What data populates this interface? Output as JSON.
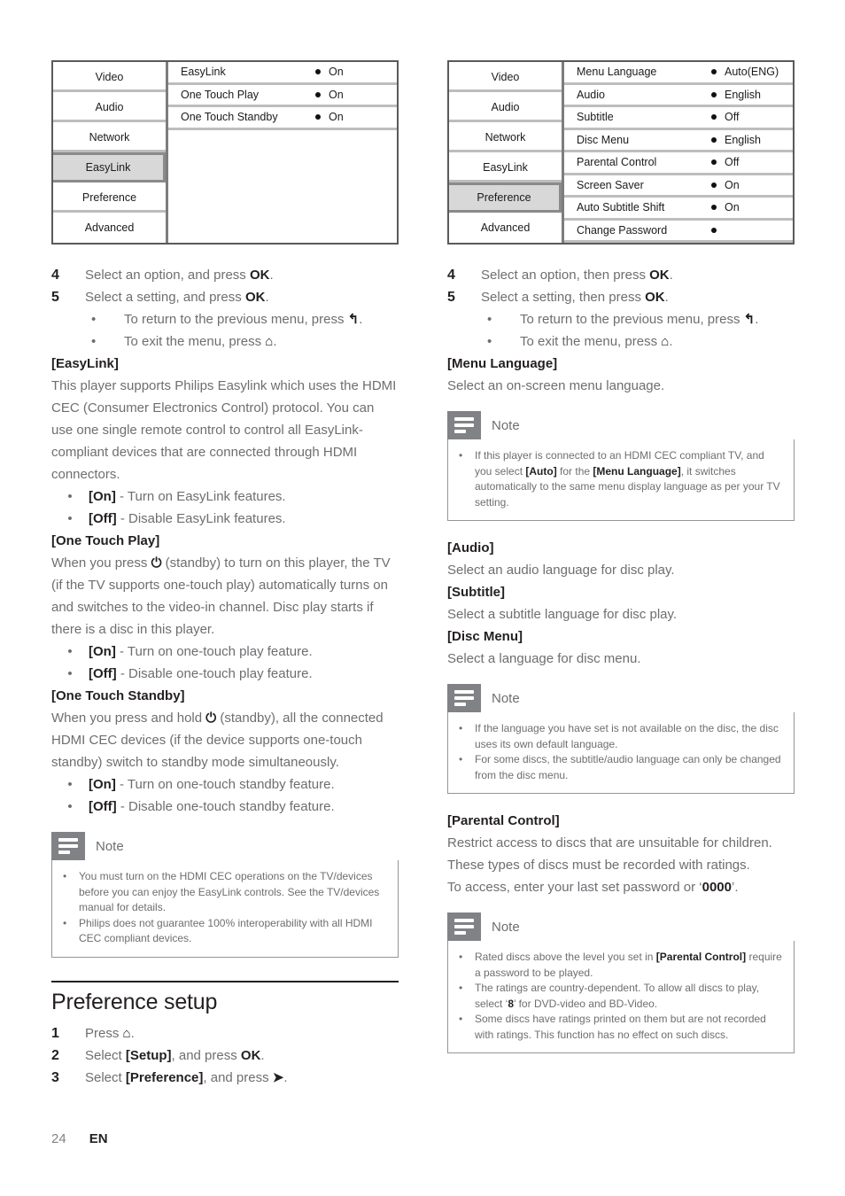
{
  "page": {
    "number": "24",
    "language": "EN"
  },
  "icons": {
    "ok": "OK",
    "return": "↰",
    "home": "⌂",
    "standby": "⏻",
    "right_arrow": "➤"
  },
  "left_column": {
    "menu_screenshot": {
      "categories": [
        {
          "label": "Video",
          "selected": false
        },
        {
          "label": "Audio",
          "selected": false
        },
        {
          "label": "Network",
          "selected": false
        },
        {
          "label": "EasyLink",
          "selected": true
        },
        {
          "label": "Preference",
          "selected": false
        },
        {
          "label": "Advanced",
          "selected": false
        }
      ],
      "options": [
        {
          "label": "EasyLink",
          "value": "On"
        },
        {
          "label": "One Touch Play",
          "value": "On"
        },
        {
          "label": "One Touch Standby",
          "value": "On"
        }
      ]
    },
    "steps": [
      {
        "num": "4",
        "pre": "Select an option, and press ",
        "bold": "OK",
        "post": "."
      },
      {
        "num": "5",
        "pre": "Select a setting, and press ",
        "bold": "OK",
        "post": "."
      }
    ],
    "sub_bullets": [
      {
        "pre": "To return to the previous menu, press ",
        "icon": "return",
        "post": "."
      },
      {
        "pre": "To exit the menu, press ",
        "icon": "home",
        "post": "."
      }
    ],
    "sections": [
      {
        "term": "[EasyLink]",
        "paragraph": "This player supports Philips Easylink which uses the HDMI CEC (Consumer Electronics Control) protocol. You can use one single remote control to control all EasyLink-compliant devices that are connected through HDMI connectors.",
        "bullets": [
          {
            "bold": "[On]",
            "rest": " - Turn on EasyLink features."
          },
          {
            "bold": "[Off]",
            "rest": " - Disable EasyLink features."
          }
        ]
      },
      {
        "term": "[One Touch Play]",
        "paragraph_pre": "When you press ",
        "paragraph_icon": "standby",
        "paragraph_post": " (standby) to turn on this player, the TV (if the TV supports one-touch play) automatically turns on and switches to the video-in channel. Disc play starts if there is a disc in this player.",
        "bullets": [
          {
            "bold": "[On]",
            "rest": " - Turn on one-touch play feature."
          },
          {
            "bold": "[Off]",
            "rest": " - Disable one-touch play feature."
          }
        ]
      },
      {
        "term": "[One Touch Standby]",
        "paragraph_pre": "When you press and hold ",
        "paragraph_icon": "standby",
        "paragraph_post": " (standby), all the connected HDMI CEC devices (if the device supports one-touch standby) switch to standby mode simultaneously.",
        "bullets": [
          {
            "bold": "[On]",
            "rest": " - Turn on one-touch standby feature."
          },
          {
            "bold": "[Off]",
            "rest": " - Disable one-touch standby feature."
          }
        ]
      }
    ],
    "note": {
      "title": "Note",
      "items": [
        "You must turn on the HDMI CEC operations on the TV/devices before you can enjoy the EasyLink controls. See the TV/devices manual for details.",
        "Philips does not guarantee 100% interoperability with all HDMI CEC compliant devices."
      ]
    },
    "section_heading": "Preference setup",
    "setup_steps": [
      {
        "num": "1",
        "pre": "Press ",
        "icon": "home",
        "post": "."
      },
      {
        "num": "2",
        "pre": "Select ",
        "bold": "[Setup]",
        "mid": ", and press ",
        "bold2": "OK",
        "post": "."
      },
      {
        "num": "3",
        "pre": "Select ",
        "bold": "[Preference]",
        "mid": ", and press ",
        "icon": "right_arrow",
        "post": "."
      }
    ]
  },
  "right_column": {
    "menu_screenshot": {
      "categories": [
        {
          "label": "Video",
          "selected": false
        },
        {
          "label": "Audio",
          "selected": false
        },
        {
          "label": "Network",
          "selected": false
        },
        {
          "label": "EasyLink",
          "selected": false
        },
        {
          "label": "Preference",
          "selected": true
        },
        {
          "label": "Advanced",
          "selected": false
        }
      ],
      "options": [
        {
          "label": "Menu Language",
          "value": "Auto(ENG)"
        },
        {
          "label": "Audio",
          "value": "English"
        },
        {
          "label": "Subtitle",
          "value": "Off"
        },
        {
          "label": "Disc Menu",
          "value": "English"
        },
        {
          "label": "Parental Control",
          "value": "Off"
        },
        {
          "label": "Screen Saver",
          "value": "On"
        },
        {
          "label": "Auto Subtitle Shift",
          "value": "On"
        },
        {
          "label": "Change Password",
          "value": ""
        }
      ]
    },
    "steps": [
      {
        "num": "4",
        "pre": "Select an option, then press ",
        "bold": "OK",
        "post": "."
      },
      {
        "num": "5",
        "pre": "Select a setting, then press ",
        "bold": "OK",
        "post": "."
      }
    ],
    "sub_bullets": [
      {
        "pre": "To return to the previous menu, press ",
        "icon": "return",
        "post": "."
      },
      {
        "pre": "To exit the menu, press ",
        "icon": "home",
        "post": "."
      }
    ],
    "menu_language": {
      "term": "[Menu Language]",
      "paragraph": "Select an on-screen menu language."
    },
    "note1": {
      "title": "Note",
      "item": {
        "p1": "If this player is connected to an HDMI CEC compliant TV, and you select ",
        "b1": "[Auto]",
        "p2": " for the ",
        "b2": "[Menu Language]",
        "p3": ", it switches automatically to the same menu display language as per your TV setting."
      }
    },
    "language_sections": [
      {
        "term": "[Audio]",
        "paragraph": "Select an audio language for disc play."
      },
      {
        "term": "[Subtitle]",
        "paragraph": "Select a subtitle language for disc play."
      },
      {
        "term": "[Disc Menu]",
        "paragraph": "Select a language for disc menu."
      }
    ],
    "note2": {
      "title": "Note",
      "items": [
        "If the language you have set is not available on the disc, the disc uses its own default language.",
        "For some discs, the subtitle/audio language can only be changed from the disc menu."
      ]
    },
    "parental": {
      "term": "[Parental Control]",
      "paragraph": "Restrict access to discs that are unsuitable for children. These types of discs must be recorded with ratings.",
      "access_pre": "To access, enter your last set password or ‘",
      "access_bold": "0000",
      "access_post": "’."
    },
    "note3": {
      "title": "Note",
      "items": [
        {
          "p1": "Rated discs above the level you set in ",
          "b1": "[Parental Control]",
          "p2": " require a password to be played."
        },
        {
          "p1": "The ratings are country-dependent. To allow all discs to play, select ‘",
          "b1": "8",
          "p2": "’ for DVD-video and BD-Video."
        },
        {
          "p1": "Some discs have ratings printed on them but are not recorded with ratings. This function has no effect on such discs.",
          "b1": "",
          "p2": ""
        }
      ]
    }
  }
}
